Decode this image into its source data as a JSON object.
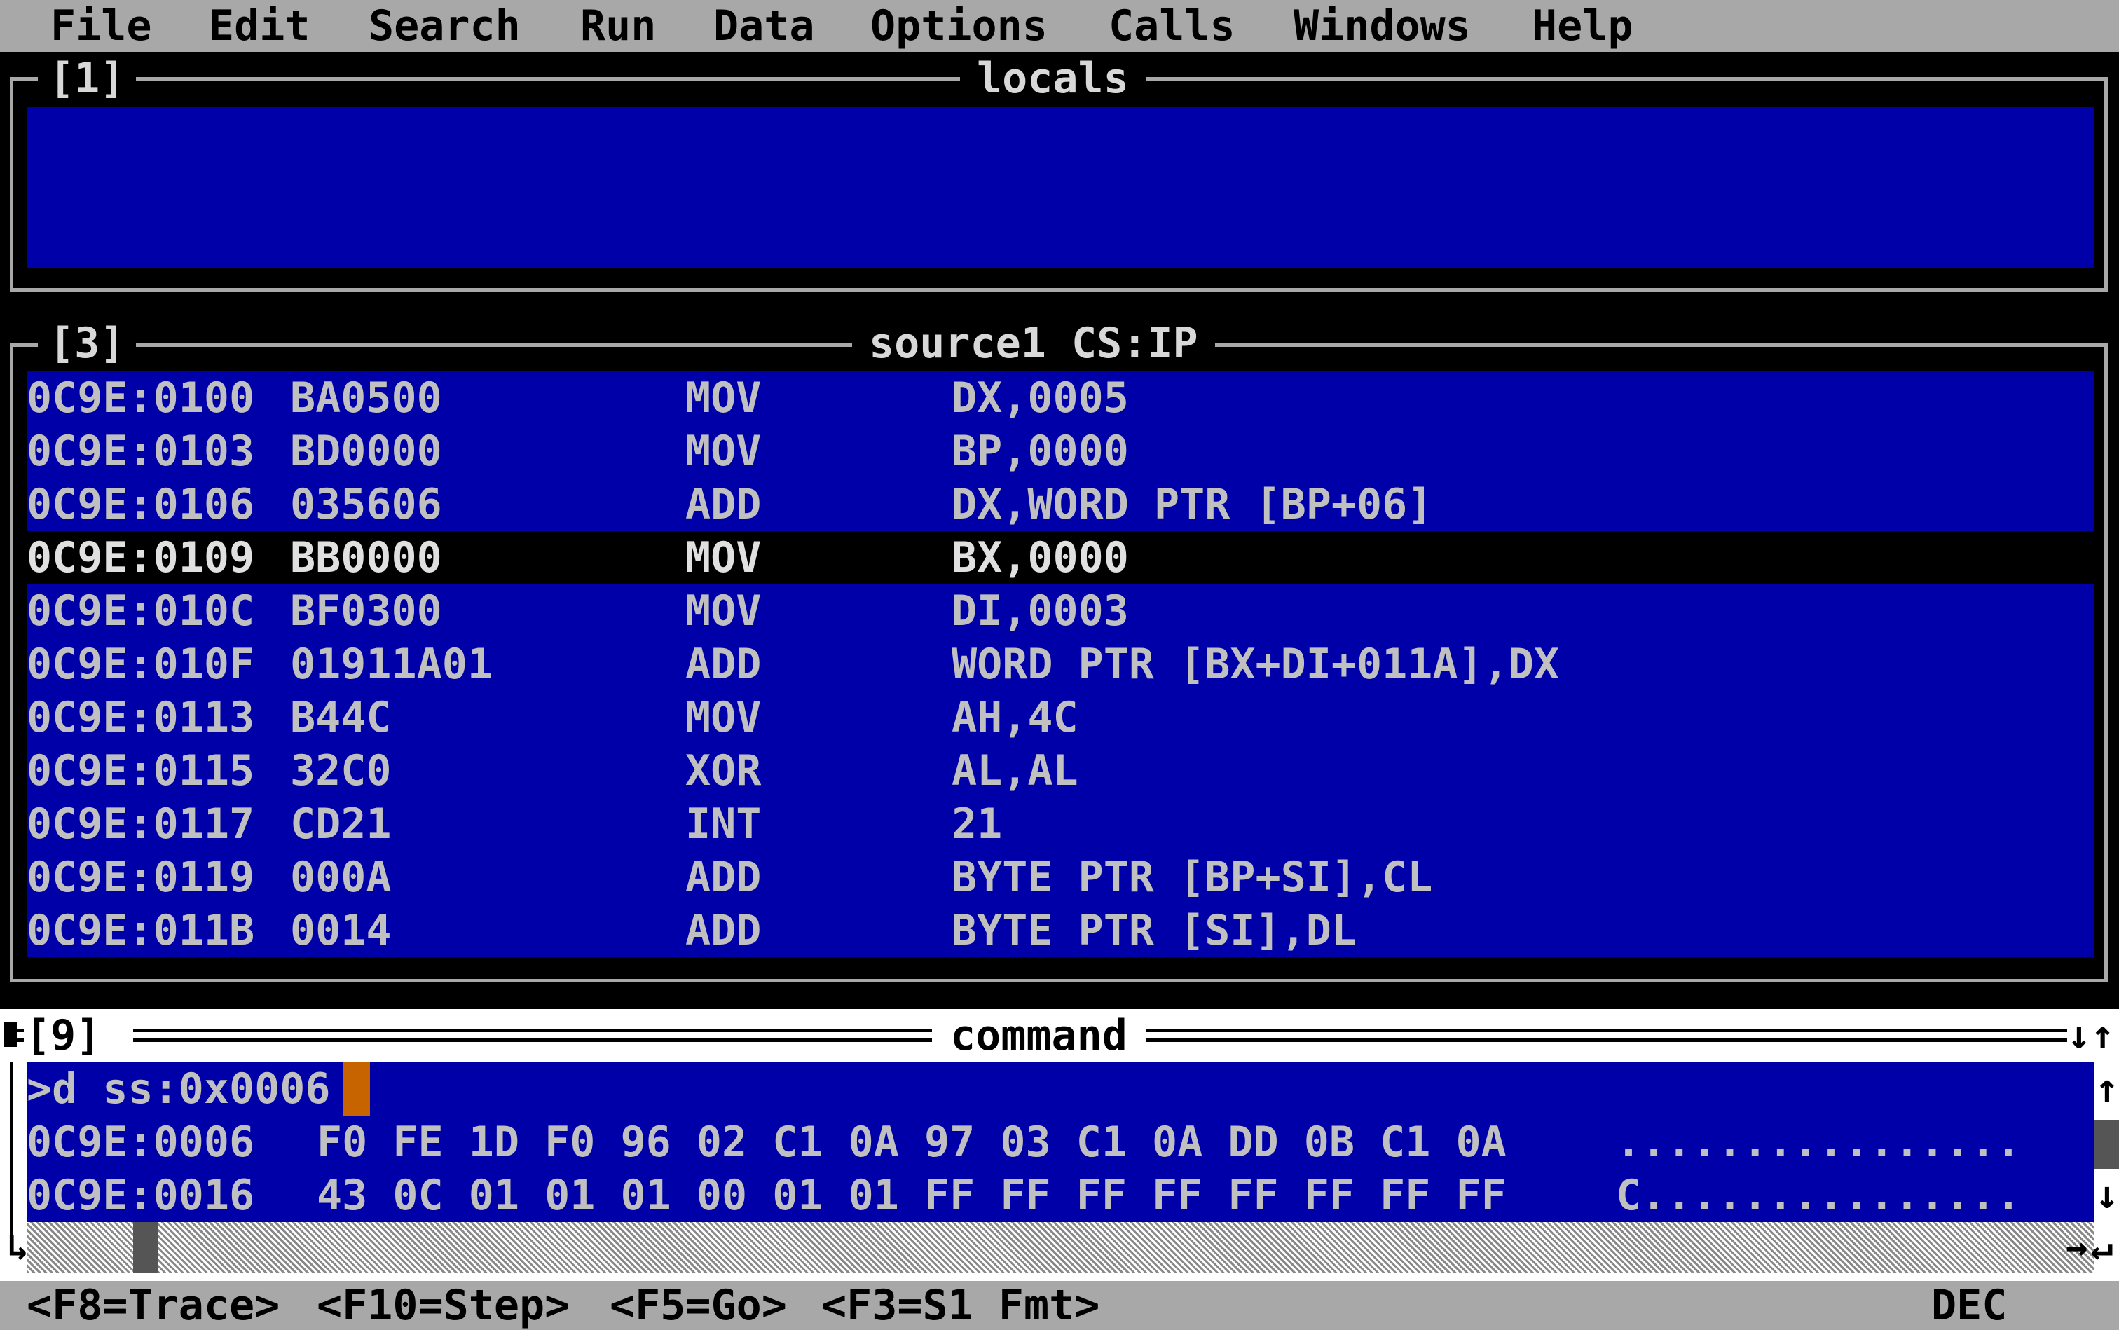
{
  "menu": {
    "items": [
      "File",
      "Edit",
      "Search",
      "Run",
      "Data",
      "Options",
      "Calls",
      "Windows",
      "Help"
    ]
  },
  "locals_window": {
    "number": "[1]",
    "title": "locals"
  },
  "source_window": {
    "number": "[3]",
    "title": "source1 CS:IP",
    "rows": [
      {
        "addr": "0C9E:0100",
        "bytes": "BA0500",
        "mnemonic": "MOV",
        "operands": "DX,0005"
      },
      {
        "addr": "0C9E:0103",
        "bytes": "BD0000",
        "mnemonic": "MOV",
        "operands": "BP,0000"
      },
      {
        "addr": "0C9E:0106",
        "bytes": "035606",
        "mnemonic": "ADD",
        "operands": "DX,WORD PTR [BP+06]"
      },
      {
        "addr": "0C9E:0109",
        "bytes": "BB0000",
        "mnemonic": "MOV",
        "operands": "BX,0000"
      },
      {
        "addr": "0C9E:010C",
        "bytes": "BF0300",
        "mnemonic": "MOV",
        "operands": "DI,0003"
      },
      {
        "addr": "0C9E:010F",
        "bytes": "01911A01",
        "mnemonic": "ADD",
        "operands": "WORD PTR [BX+DI+011A],DX"
      },
      {
        "addr": "0C9E:0113",
        "bytes": "B44C",
        "mnemonic": "MOV",
        "operands": "AH,4C"
      },
      {
        "addr": "0C9E:0115",
        "bytes": "32C0",
        "mnemonic": "XOR",
        "operands": "AL,AL"
      },
      {
        "addr": "0C9E:0117",
        "bytes": "CD21",
        "mnemonic": "INT",
        "operands": "21"
      },
      {
        "addr": "0C9E:0119",
        "bytes": "000A",
        "mnemonic": "ADD",
        "operands": "BYTE PTR [BP+SI],CL"
      },
      {
        "addr": "0C9E:011B",
        "bytes": "0014",
        "mnemonic": "ADD",
        "operands": "BYTE PTR [SI],DL"
      }
    ]
  },
  "command_window": {
    "number": "[9]",
    "title": "command",
    "input": ">d ss:0x0006",
    "dump": [
      {
        "addr": "0C9E:0006",
        "hex": "F0 FE 1D F0 96 02 C1 0A 97 03 C1 0A DD 0B C1 0A",
        "ascii": "................"
      },
      {
        "addr": "0C9E:0016",
        "hex": "43 0C 01 01 01 00 01 01 FF FF FF FF FF FF FF FF",
        "ascii": "C..............."
      }
    ]
  },
  "statusbar": {
    "trace": "<F8=Trace>",
    "step": "<F10=Step>",
    "go": "<F5=Go>",
    "fmt": "<F3=S1 Fmt>",
    "radix": "DEC"
  },
  "colors": {
    "window_blue": "#0000a8",
    "menu_gray": "#a8a8a8",
    "cursor_orange": "#c86400"
  }
}
